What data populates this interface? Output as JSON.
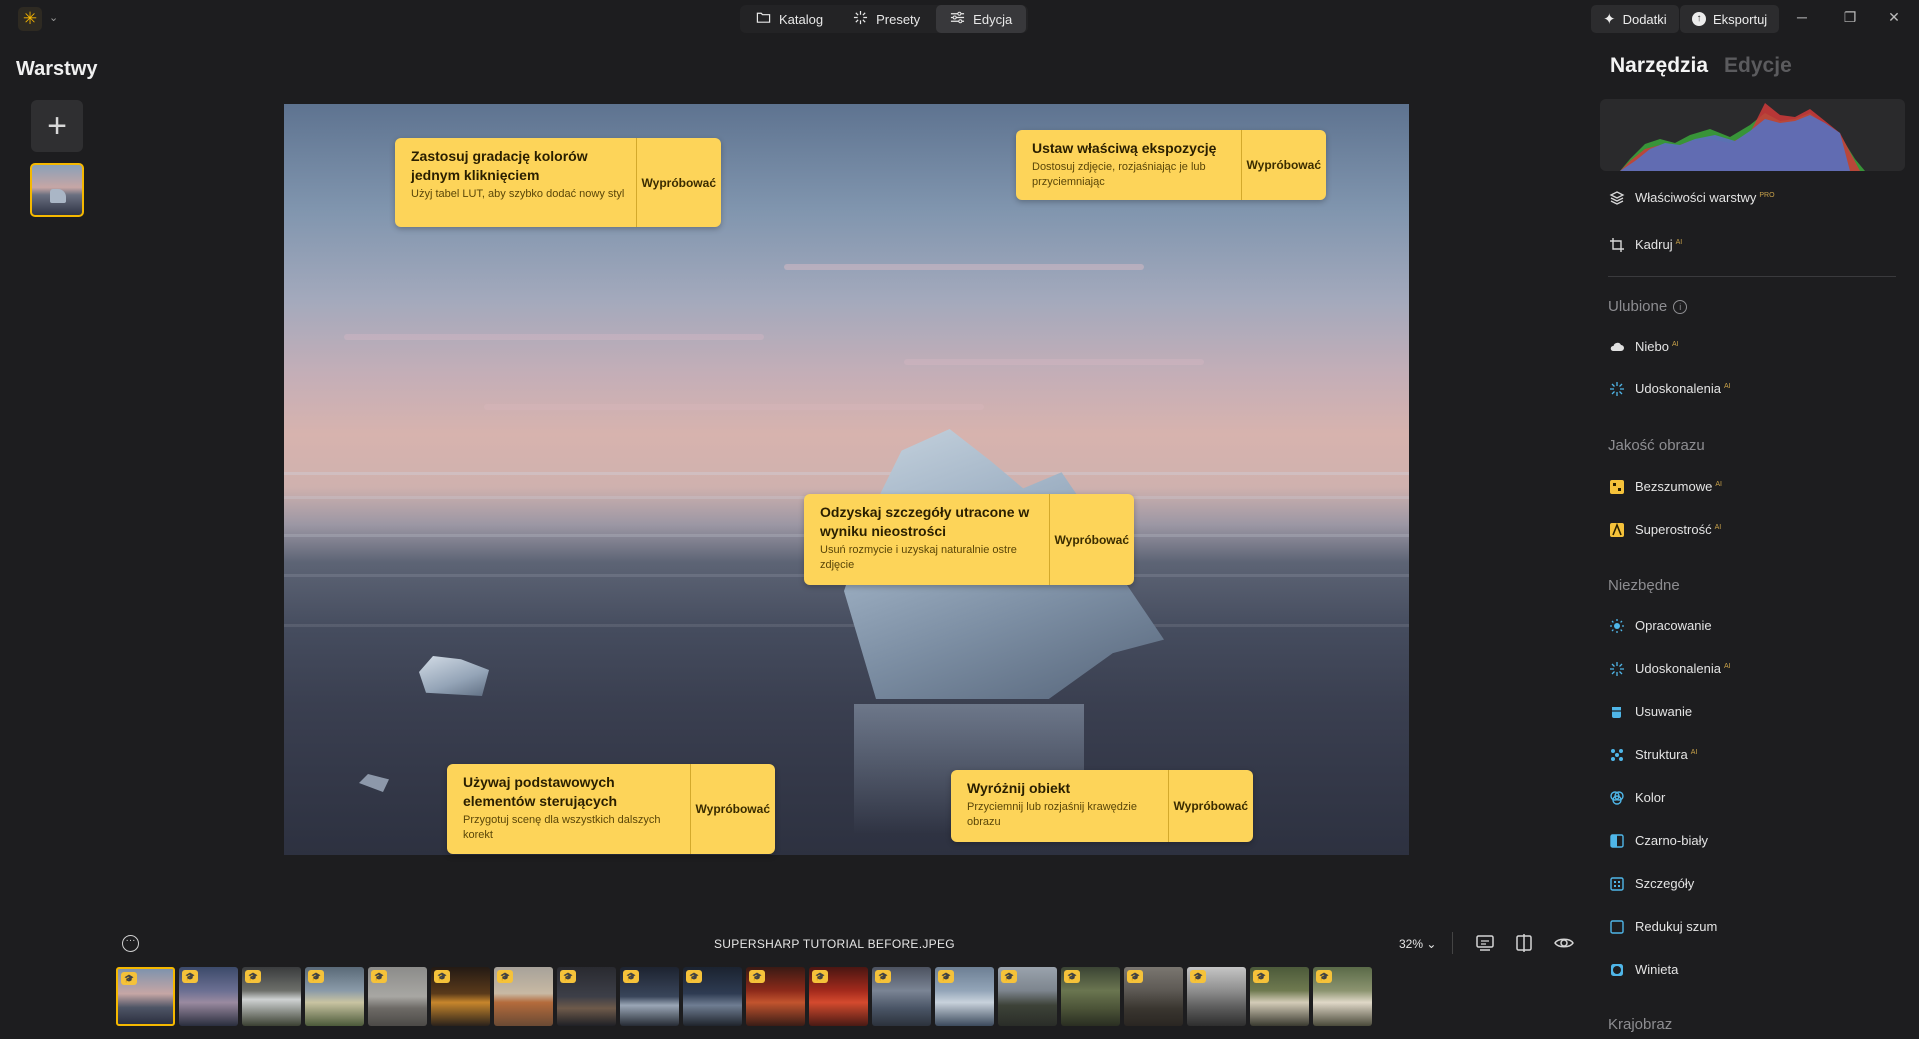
{
  "app": {
    "tabs": [
      {
        "label": "Katalog",
        "icon": "folder-icon"
      },
      {
        "label": "Presety",
        "icon": "sparkle-icon"
      },
      {
        "label": "Edycja",
        "icon": "sliders-icon",
        "active": true
      }
    ],
    "addons_label": "Dodatki",
    "export_label": "Eksportuj",
    "brand_color": "#f5b800"
  },
  "left_panel": {
    "title": "Warstwy",
    "add_label": "+"
  },
  "tips": [
    {
      "title": "Zastosuj gradację kolorów jednym kliknięciem",
      "desc": "Użyj tabel LUT, aby szybko dodać nowy styl",
      "button": "Wypróbować"
    },
    {
      "title": "Ustaw właściwą ekspozycję",
      "desc": "Dostosuj zdjęcie, rozjaśniając je lub przyciemniając",
      "button": "Wypróbować"
    },
    {
      "title": "Odzyskaj szczegóły utracone w wyniku nieostrości",
      "desc": "Usuń rozmycie i uzyskaj naturalnie ostre zdjęcie",
      "button": "Wypróbować"
    },
    {
      "title": "Używaj podstawowych elementów sterujących",
      "desc": "Przygotuj scenę dla wszystkich dalszych korekt",
      "button": "Wypróbować"
    },
    {
      "title": "Wyróżnij obiekt",
      "desc": "Przyciemnij lub rozjaśnij krawędzie obrazu",
      "button": "Wypróbować"
    }
  ],
  "right_panel": {
    "tabs": [
      "Narzędzia",
      "Edycje"
    ],
    "top_items": [
      {
        "label": "Właściwości warstwy",
        "badge": "PRO",
        "icon": "layers-icon"
      },
      {
        "label": "Kadruj",
        "badge": "AI",
        "icon": "crop-icon"
      }
    ],
    "sections": [
      {
        "title": "Ulubione",
        "items": [
          {
            "label": "Niebo",
            "badge": "AI",
            "icon": "cloud-icon"
          },
          {
            "label": "Udoskonalenia",
            "badge": "AI",
            "icon": "sparkle-icon"
          }
        ]
      },
      {
        "title": "Jakość obrazu",
        "items": [
          {
            "label": "Bezszumowe",
            "badge": "AI",
            "icon": "noiseless-icon"
          },
          {
            "label": "Superostrość",
            "badge": "AI",
            "icon": "supersharp-icon"
          }
        ]
      },
      {
        "title": "Niezbędne",
        "items": [
          {
            "label": "Opracowanie",
            "badge": "",
            "icon": "sun-icon"
          },
          {
            "label": "Udoskonalenia",
            "badge": "AI",
            "icon": "sparkle-icon"
          },
          {
            "label": "Usuwanie",
            "badge": "",
            "icon": "eraser-icon"
          },
          {
            "label": "Struktura",
            "badge": "AI",
            "icon": "structure-icon"
          },
          {
            "label": "Kolor",
            "badge": "",
            "icon": "color-icon"
          },
          {
            "label": "Czarno-biały",
            "badge": "",
            "icon": "bw-icon"
          },
          {
            "label": "Szczegóły",
            "badge": "",
            "icon": "details-icon"
          },
          {
            "label": "Redukuj szum",
            "badge": "",
            "icon": "denoise-icon"
          },
          {
            "label": "Winieta",
            "badge": "",
            "icon": "vignette-icon"
          }
        ]
      },
      {
        "title": "Krajobraz",
        "items": []
      }
    ]
  },
  "bottom": {
    "filename": "SUPERSHARP TUTORIAL BEFORE.JPEG",
    "zoom": "32%"
  },
  "filmstrip": [
    {
      "g": "linear-gradient(180deg,#7f93ad,#c6a6a5 45%,#4e5566 70%,#2c3040)"
    },
    {
      "g": "linear-gradient(180deg,#3c4a6a,#6b6f92 40%,#9a8aa0 60%,#2a2e3e)"
    },
    {
      "g": "linear-gradient(180deg,#3a3c3e,#6d6f6a 40%,#cfd2d2 55%,#3b4032)"
    },
    {
      "g": "linear-gradient(180deg,#5a6a78,#8a9aa8 40%,#c9c4a2 60%,#4c5a3a)"
    },
    {
      "g": "linear-gradient(180deg,#8c8c8a,#a8a7a3 50%,#6d6a66 70%,#4c4a47)"
    },
    {
      "g": "linear-gradient(180deg,#241a14,#5a3a1a 45%,#c7862c 60%,#2a221b)"
    },
    {
      "g": "linear-gradient(180deg,#a7a29a,#c8b9a3 45%,#b46b3c 60%,#6a4a34)"
    },
    {
      "g": "linear-gradient(180deg,#292a30,#3d3f48 50%,#6e5a4a 70%,#1f2026)"
    },
    {
      "g": "linear-gradient(180deg,#1d2330,#39455a 50%,#9aa6b6 65%,#262b34)"
    },
    {
      "g": "linear-gradient(180deg,#1b2330,#2e3b52 45%,#6f7d92 65%,#1f242c)"
    },
    {
      "g": "linear-gradient(180deg,#3a1a14,#8c2a1a 40%,#c2542e 60%,#3a1c16)"
    },
    {
      "g": "linear-gradient(180deg,#4a1612,#a32a1c 40%,#d44a2e 60%,#4a1a14)"
    },
    {
      "g": "linear-gradient(180deg,#4c5260,#7a8494 40%,#4a5566 70%,#2c323c)"
    },
    {
      "g": "linear-gradient(180deg,#6d7f94,#93a5b8 40%,#c8d2dc 60%,#3c4a5c)"
    },
    {
      "g": "linear-gradient(180deg,#9aa3ad,#7d858e 40%,#3d4238 65%,#2a2d28)"
    },
    {
      "g": "linear-gradient(180deg,#3b4434,#6a7550 40%,#4c5438 70%,#2a2e22)"
    },
    {
      "g": "linear-gradient(180deg,#7a7670,#5d5954 40%,#3a3630 70%,#2a2622)"
    },
    {
      "g": "linear-gradient(180deg,#c5c5c5,#8e8e8e 40%,#5a5a5a 70%,#2e2e2e)"
    },
    {
      "g": "linear-gradient(180deg,#4c5a3a,#6f7a50 40%,#d4ccb8 60%,#3a3a30)"
    },
    {
      "g": "linear-gradient(180deg,#5a6a48,#8c9470 40%,#e0d8c8 60%,#4a4a3a)"
    }
  ]
}
